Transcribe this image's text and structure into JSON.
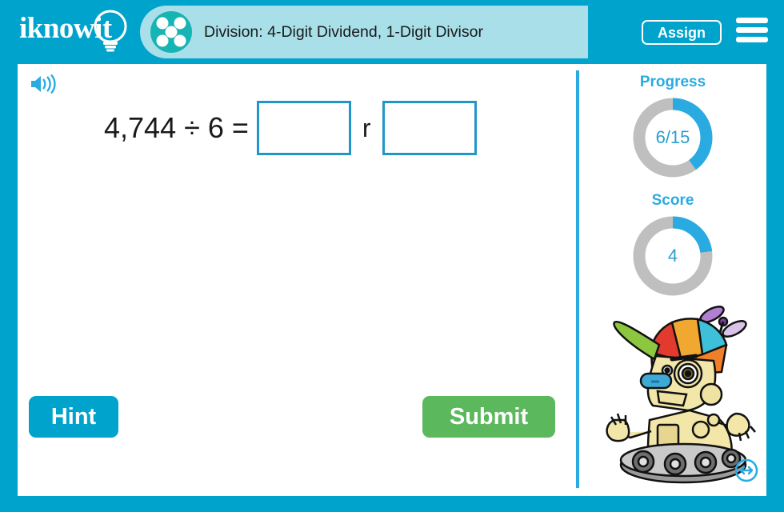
{
  "header": {
    "logo_text": "iknowit",
    "logo_icon": "lightbulb-icon",
    "title": "Division: 4-Digit Dividend, 1-Digit Divisor",
    "title_icon": "five-dots-circle-icon",
    "assign_label": "Assign",
    "menu_icon": "hamburger-menu-icon",
    "background_color": "#00a3cc",
    "title_band_color": "#a8dfe8"
  },
  "question": {
    "speaker_icon": "speaker-volume-icon",
    "equation": "4,744 ÷ 6 =",
    "dividend": "4,744",
    "divisor": "6",
    "quotient_value": "",
    "remainder_label": "r",
    "remainder_value": "",
    "input_placeholder": ""
  },
  "actions": {
    "hint_label": "Hint",
    "hint_color": "#00a3cc",
    "submit_label": "Submit",
    "submit_color": "#5cb85c"
  },
  "sidebar": {
    "progress": {
      "label": "Progress",
      "value_text": "6/15",
      "completed": 6,
      "total": 15,
      "percent": 40,
      "arc_color": "#29abe2",
      "track_color": "#bfbfbf"
    },
    "score": {
      "label": "Score",
      "value_text": "4",
      "value": 4,
      "percent": 23,
      "arc_color": "#29abe2",
      "track_color": "#bfbfbf"
    },
    "mascot_icon": "robot-mascot-propeller-hat",
    "resize_icon": "resize-horizontal-icon"
  }
}
